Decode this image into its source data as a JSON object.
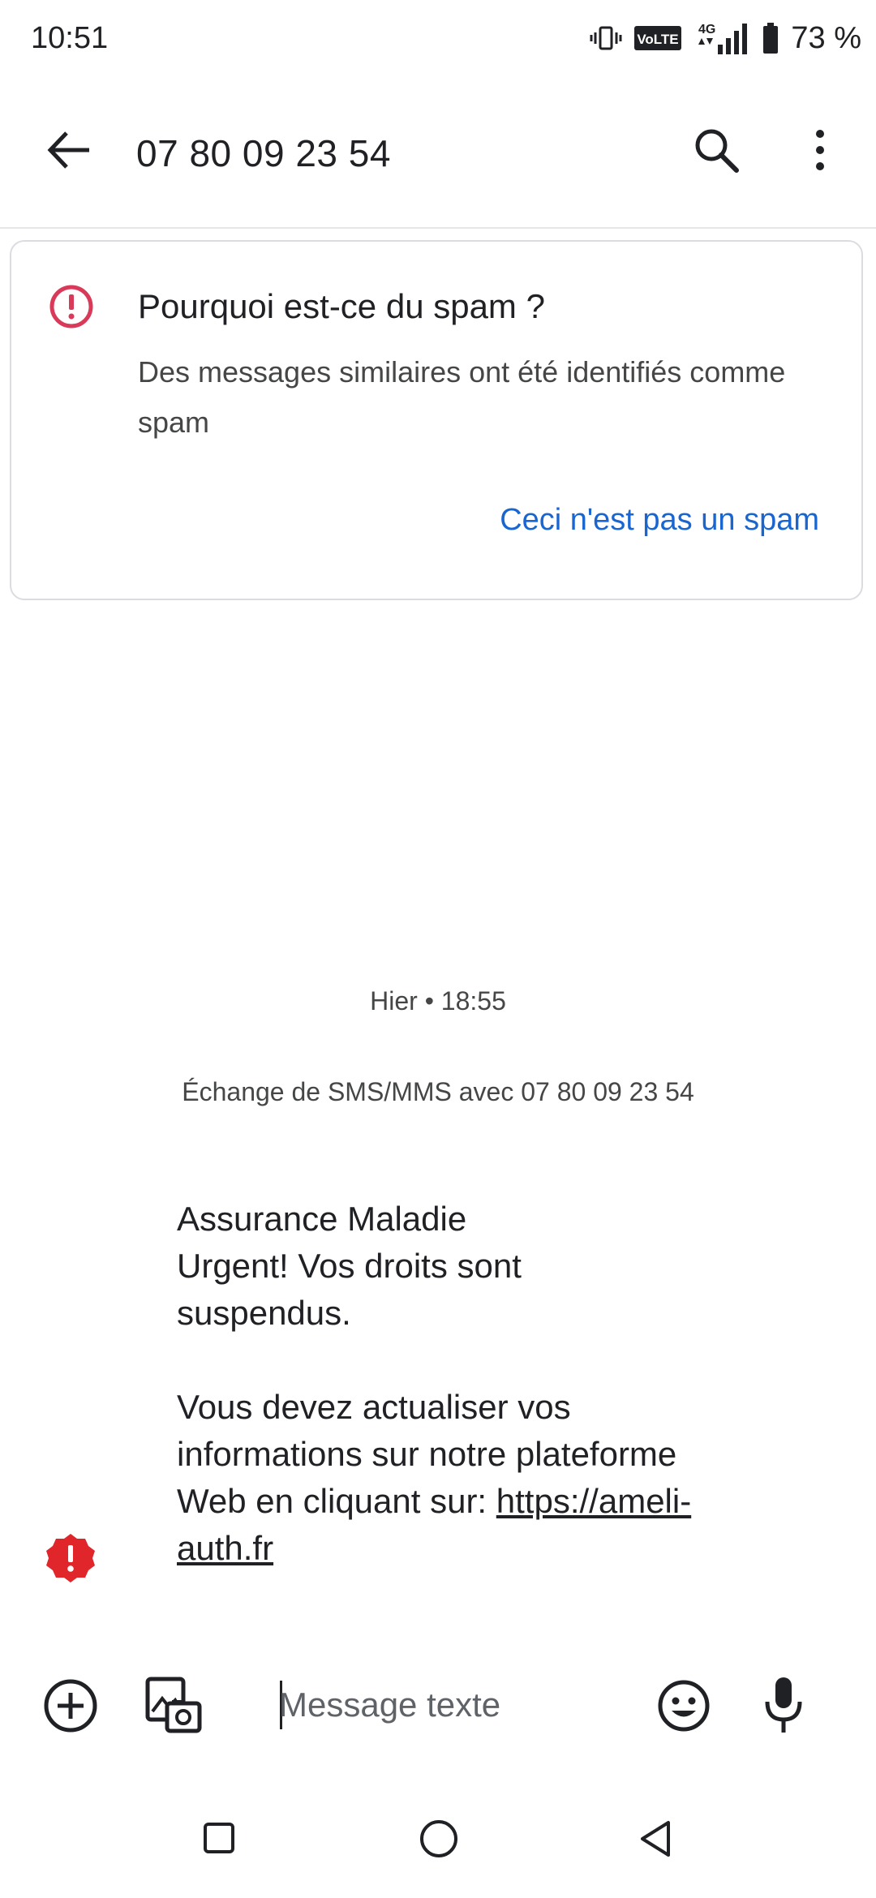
{
  "status_bar": {
    "time": "10:51",
    "volte_label": "VoLTE",
    "network_label": "4G",
    "battery_text": "73 %",
    "icons": [
      "vibrate-icon",
      "volte-icon",
      "signal-icon",
      "battery-icon"
    ]
  },
  "app_bar": {
    "title": "07 80 09 23 54",
    "icons": [
      "back-arrow-icon",
      "search-icon",
      "more-vert-icon"
    ]
  },
  "spam_card": {
    "heading": "Pourquoi est-ce du spam ?",
    "description": "Des messages similaires ont été identifiés comme spam",
    "action_label": "Ceci n'est pas un spam",
    "icon": "alert-circle-icon"
  },
  "conversation": {
    "timestamp": "Hier  • 18:55",
    "exchange_info": "Échange de SMS/MMS avec 07 80 09 23 54",
    "message": {
      "line1": "Assurance Maladie",
      "line2": "Urgent! Vos droits sont suspendus.",
      "line3": "Vous devez actualiser vos informations sur notre plateforme Web en cliquant sur: ",
      "link": "https://ameli-auth.fr",
      "status_icon": "error-badge-icon"
    }
  },
  "compose": {
    "placeholder": "Message texte",
    "icons": [
      "add-circle-icon",
      "gallery-icon",
      "emoji-icon",
      "mic-icon"
    ]
  },
  "colors": {
    "accent_link": "#1a66d1",
    "warning_pink": "#d93a5a",
    "error_red": "#e0262b",
    "text_primary": "#202124",
    "text_secondary": "#444746"
  }
}
